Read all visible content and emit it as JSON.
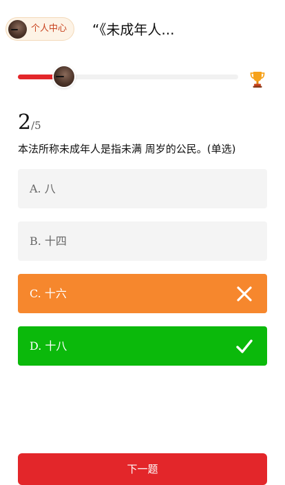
{
  "header": {
    "personal_center_label": "个人中心",
    "quiz_title": "“《未成年人..."
  },
  "progress": {
    "current": 2,
    "total": 5,
    "fraction": 0.2
  },
  "question": {
    "number": "2",
    "total_label": "/5",
    "text": "本法所称未成年人是指未满 周岁的公民。(单选)"
  },
  "options": [
    {
      "label": "A. 八",
      "state": "neutral"
    },
    {
      "label": "B. 十四",
      "state": "neutral"
    },
    {
      "label": "C. 十六",
      "state": "wrong",
      "icon": "close-icon"
    },
    {
      "label": "D. 十八",
      "state": "right",
      "icon": "check-icon"
    }
  ],
  "footer": {
    "next_label": "下一题"
  },
  "colors": {
    "accent_red": "#e3262a",
    "wrong_orange": "#f6872d",
    "correct_green": "#0bb90b",
    "neutral_gray": "#f4f4f4"
  }
}
